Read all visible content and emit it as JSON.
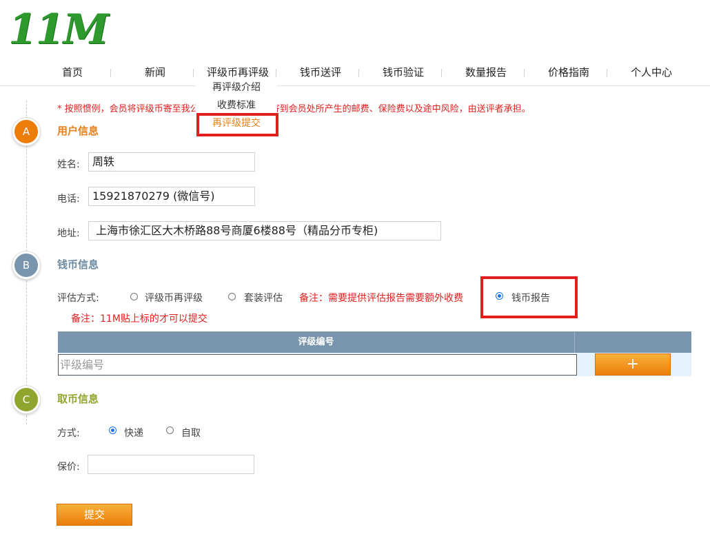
{
  "logo": {
    "text": "11M"
  },
  "nav": {
    "items": [
      "首页",
      "新闻",
      "评级币再评级",
      "钱币送评",
      "钱币验证",
      "数量报告",
      "价格指南",
      "个人中心"
    ]
  },
  "dropdown": {
    "items": [
      "再评级介绍",
      "收费标准",
      "再评级提交"
    ],
    "active_index": 2
  },
  "notice": "* 按照惯例，会员将评级币寄至我公司或我公司将钱币寄到会员处所产生的邮费、保险费以及途中风险，由送评者承担。",
  "section_a": {
    "badge": "A",
    "title": "用户信息",
    "name_label": "姓名:",
    "name_value": "周轶",
    "phone_label": "电话:",
    "phone_value": "15921870279 (微信号)",
    "address_label": "地址:",
    "address_value": " 上海市徐汇区大木桥路88号商厦6楼88号（精品分币专柜)"
  },
  "section_b": {
    "badge": "B",
    "title": "钱币信息",
    "method_label": "评估方式:",
    "options": [
      "评级币再评级",
      "套装评估",
      "钱币报告"
    ],
    "selected": "钱币报告",
    "option_note": "备注：需要提供评估报告需要额外收费",
    "note": "备注：11M贴上标的才可以提交",
    "table_header": "评级编号",
    "grade_placeholder": "评级编号",
    "add_label": "+"
  },
  "section_c": {
    "badge": "C",
    "title": "取币信息",
    "method_label": "方式:",
    "options": [
      "快递",
      "自取"
    ],
    "selected": "快递",
    "insurance_label": "保价:",
    "insurance_value": ""
  },
  "submit_label": "提交",
  "colors": {
    "logo_green": "#2e9a2e",
    "badge_a": "#ec7d0a",
    "badge_b": "#7895ad",
    "badge_c": "#8fa52e",
    "notice_red": "#e0201f",
    "title_orange": "#e8801a",
    "title_blue": "#6d8aa3",
    "title_green": "#8fa52e"
  }
}
